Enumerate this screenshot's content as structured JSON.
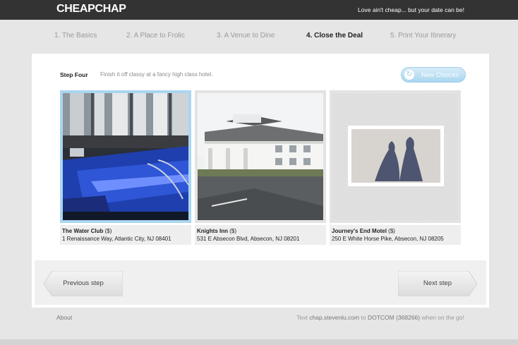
{
  "header": {
    "logo": "CHEAPCHAP",
    "tagline": "Love ain't cheap... but your date can be!"
  },
  "steps": [
    {
      "label": "1. The Basics",
      "active": false
    },
    {
      "label": "2. A Place to Frolic",
      "active": false
    },
    {
      "label": "3. A Venue to Dine",
      "active": false
    },
    {
      "label": "4. Close the Deal",
      "active": true
    },
    {
      "label": "5. Print Your Itinerary",
      "active": false
    }
  ],
  "panel": {
    "step_label": "Step Four",
    "step_desc": "Finish it off classy at a fancy high class hotel.",
    "new_choices": "New Choices",
    "new_choices_icon": "refresh-icon"
  },
  "cards": [
    {
      "name": "The Water Club",
      "price": "($)",
      "address": "1 Renaissance Way, Atlantic City, NJ 08401",
      "selected": true
    },
    {
      "name": "Knights Inn",
      "price": "($)",
      "address": "531 E Absecon Blvd, Absecon, NJ 08201",
      "selected": false
    },
    {
      "name": "Journey's End Motel",
      "price": "($)",
      "address": "250 E White Horse Pike, Absecon, NJ 08205",
      "selected": false
    }
  ],
  "nav": {
    "previous": "Previous step",
    "next": "Next step"
  },
  "footer": {
    "about": "About",
    "text_prefix": "Text",
    "domain": "chap.stevenlu.com",
    "text_to": "to",
    "shortcode": "DOTCOM (368266)",
    "text_suffix": "when on the go!"
  },
  "colors": {
    "topbar": "#333333",
    "accent": "#a9d6f0",
    "background": "#e6e6e6"
  }
}
